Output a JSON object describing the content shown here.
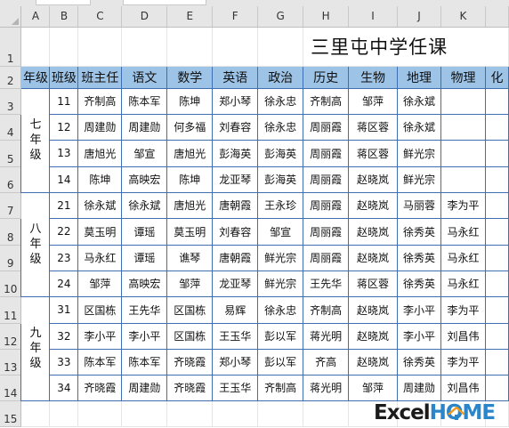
{
  "columns": [
    "A",
    "B",
    "C",
    "D",
    "E",
    "F",
    "G",
    "H",
    "I",
    "J",
    "K",
    ""
  ],
  "rows": [
    "1",
    "2",
    "3",
    "4",
    "5",
    "6",
    "7",
    "8",
    "9",
    "10",
    "11",
    "12",
    "13",
    "14",
    "15"
  ],
  "title": "三里屯中学任课",
  "headers": [
    "年级",
    "班级",
    "班主任",
    "语文",
    "数学",
    "英语",
    "政治",
    "历史",
    "生物",
    "地理",
    "物理",
    "化"
  ],
  "grades": [
    {
      "label": "七\n年\n级"
    },
    {
      "label": "八\n年\n级"
    },
    {
      "label": "九\n年\n级"
    }
  ],
  "table_rows": [
    [
      "11",
      "齐制高",
      "陈本军",
      "陈坤",
      "郑小琴",
      "徐永忠",
      "齐制高",
      "邹萍",
      "徐永斌",
      "",
      ""
    ],
    [
      "12",
      "周建勋",
      "周建勋",
      "何多福",
      "刘春容",
      "徐永忠",
      "周丽霞",
      "蒋区蓉",
      "徐永斌",
      "",
      ""
    ],
    [
      "13",
      "唐旭光",
      "邹宣",
      "唐旭光",
      "彭海英",
      "彭海英",
      "周丽霞",
      "蒋区蓉",
      "鲜光宗",
      "",
      ""
    ],
    [
      "14",
      "陈坤",
      "高映宏",
      "陈坤",
      "龙亚琴",
      "彭海英",
      "周丽霞",
      "赵晓岚",
      "鲜光宗",
      "",
      ""
    ],
    [
      "21",
      "徐永斌",
      "徐永斌",
      "唐旭光",
      "唐朝霞",
      "王永珍",
      "周丽霞",
      "赵晓岚",
      "马丽蓉",
      "李为平",
      ""
    ],
    [
      "22",
      "莫玉明",
      "谭瑶",
      "莫玉明",
      "刘春容",
      "邹宣",
      "周丽霞",
      "赵晓岚",
      "徐秀英",
      "马永红",
      ""
    ],
    [
      "23",
      "马永红",
      "谭瑶",
      "谯琴",
      "唐朝霞",
      "鲜光宗",
      "周丽霞",
      "赵晓岚",
      "徐秀英",
      "马永红",
      ""
    ],
    [
      "24",
      "邹萍",
      "高映宏",
      "邹萍",
      "龙亚琴",
      "鲜光宗",
      "王先华",
      "蒋区蓉",
      "徐秀英",
      "马永红",
      ""
    ],
    [
      "31",
      "区国栋",
      "王先华",
      "区国栋",
      "易辉",
      "徐永忠",
      "齐制高",
      "赵晓岚",
      "李小平",
      "李为平",
      ""
    ],
    [
      "32",
      "李小平",
      "李小平",
      "区国栋",
      "王玉华",
      "彭以军",
      "蒋光明",
      "赵晓岚",
      "李小平",
      "刘昌伟",
      ""
    ],
    [
      "33",
      "陈本军",
      "陈本军",
      "齐晓霞",
      "郑小琴",
      "彭以军",
      "齐高",
      "赵晓岚",
      "徐秀英",
      "李为平",
      ""
    ],
    [
      "34",
      "齐晓霞",
      "周建勋",
      "齐晓霞",
      "王玉华",
      "齐制高",
      "蒋光明",
      "邹萍",
      "周建勋",
      "刘昌伟",
      ""
    ]
  ],
  "logo": {
    "excel": "Excel",
    "home": "HOME"
  },
  "colors": {
    "header_fill": "#9dc3e6",
    "border": "#3f6fb0",
    "logo_blue": "#2a86c8",
    "logo_orange": "#f39a1e"
  }
}
